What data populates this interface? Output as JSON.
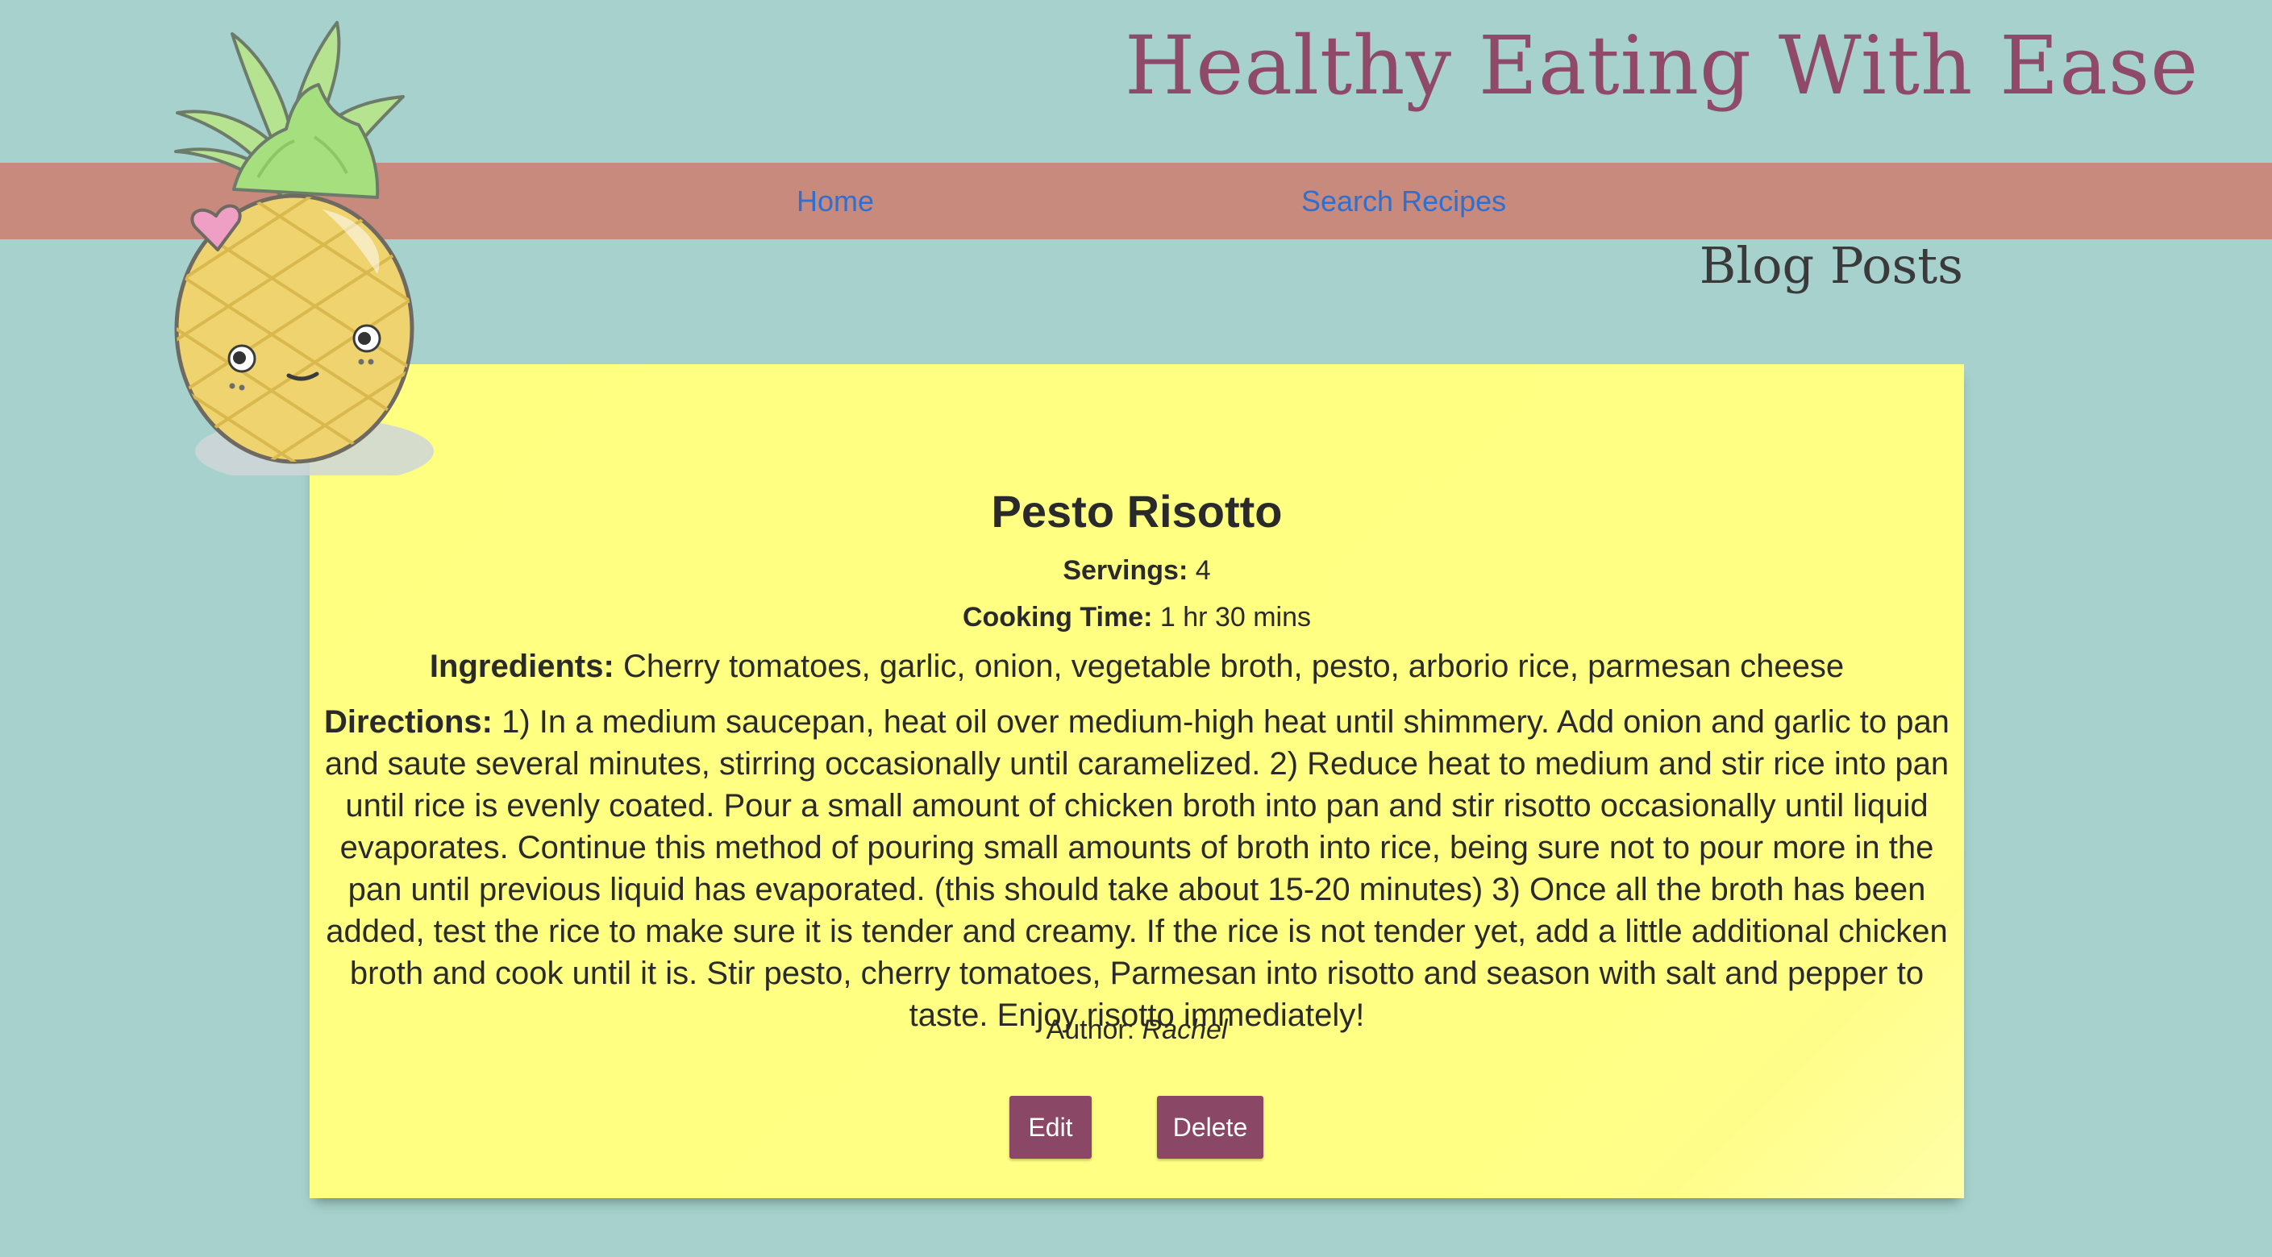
{
  "site": {
    "title": "Healthy Eating With Ease"
  },
  "nav": {
    "items": [
      {
        "label": "Home"
      },
      {
        "label": "Search Recipes"
      }
    ]
  },
  "page": {
    "heading": "Blog Posts"
  },
  "post": {
    "title": "Pesto Risotto",
    "servings_label": "Servings:",
    "servings_value": "4",
    "time_label": "Cooking Time:",
    "time_value": "1 hr 30 mins",
    "ingredients_label": "Ingredients:",
    "ingredients_value": "Cherry tomatoes, garlic, onion, vegetable broth, pesto, arborio rice, parmesan cheese",
    "directions_label": "Directions:",
    "directions_value": "1) In a medium saucepan, heat oil over medium-high heat until shimmery. Add onion and garlic to pan and saute several minutes, stirring occasionally until caramelized. 2) Reduce heat to medium and stir rice into pan until rice is evenly coated. Pour a small amount of chicken broth into pan and stir risotto occasionally until liquid evaporates. Continue this method of pouring small amounts of broth into rice, being sure not to pour more in the pan until previous liquid has evaporated. (this should take about 15-20 minutes) 3) Once all the broth has been added, test the rice to make sure it is tender and creamy. If the rice is not tender yet, add a little additional chicken broth and cook until it is. Stir pesto, cherry tomatoes, Parmesan into risotto and season with salt and pepper to taste. Enjoy risotto immediately!",
    "author_label": "Author:",
    "author_name": "Rachel"
  },
  "actions": {
    "edit_label": "Edit",
    "delete_label": "Delete"
  },
  "icons": {
    "mascot": "pineapple-mascot-icon",
    "heart": "heart-icon"
  },
  "colors": {
    "background": "#a6d1cc",
    "nav_bar": "#c88a7c",
    "title": "#8e4a68",
    "link": "#2e6fd0",
    "card": "#ffff80",
    "button": "#8a4866"
  }
}
